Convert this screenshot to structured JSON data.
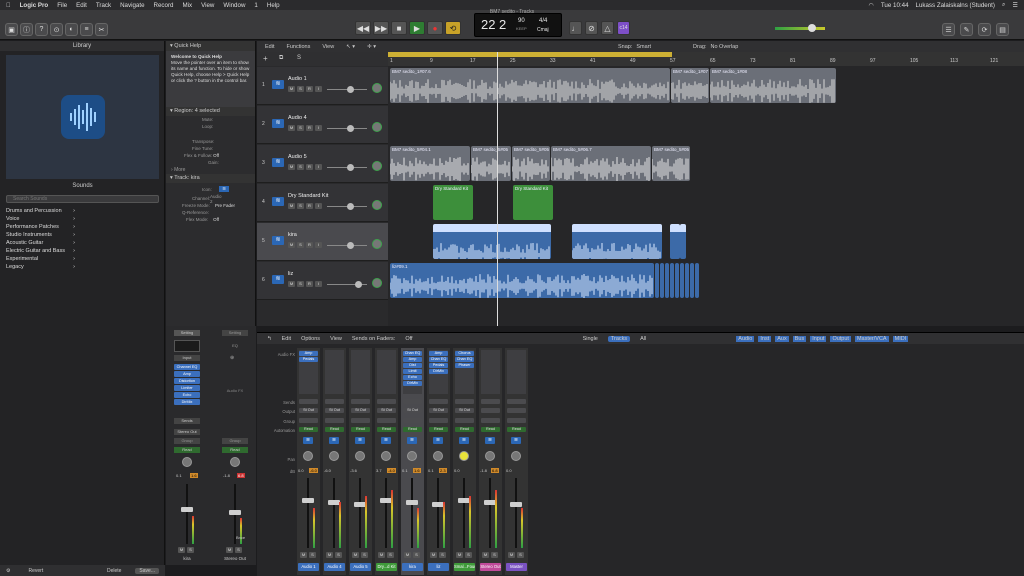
{
  "menubar": {
    "app": "Logic Pro",
    "items": [
      "File",
      "Edit",
      "Track",
      "Navigate",
      "Record",
      "Mix",
      "View",
      "Window",
      "1",
      "Help"
    ],
    "time": "Tue 10:44",
    "user": "Lukass Zalaiskalns (Student)"
  },
  "window_title": "BM7 sedito - Tracks",
  "lcd": {
    "bar": "22",
    "beat": "2",
    "tempo": "90",
    "tempo_label": "KEEP",
    "sig": "4/4",
    "key": "Cmaj"
  },
  "count_in": "c14",
  "library": {
    "title": "Library",
    "sounds_label": "Sounds",
    "search_placeholder": "Search Sounds",
    "items": [
      "Drums and Percussion",
      "Voice",
      "Performance Patches",
      "Studio Instruments",
      "Acoustic Guitar",
      "Electric Guitar and Bass",
      "Experimental",
      "Legacy"
    ],
    "footer": {
      "revert": "Revert",
      "delete": "Delete",
      "save": "Save..."
    }
  },
  "quick_help": {
    "title": "Quick Help",
    "heading": "Welcome to Quick Help",
    "body": "Move the pointer over an item to show its name and function. To hide or show Quick Help, choose Help > Quick Help or click the ? button in the control bar."
  },
  "region_inspector": {
    "title": "Region: 4 selected",
    "rows": [
      {
        "label": "Mute:",
        "value": ""
      },
      {
        "label": "Loop:",
        "value": ""
      },
      {
        "label": "Transpose:",
        "value": ""
      },
      {
        "label": "Fine Tune:",
        "value": ""
      },
      {
        "label": "Flex & Follow:",
        "value": "Off"
      },
      {
        "label": "Gain:",
        "value": ""
      }
    ],
    "more": "More"
  },
  "track_inspector": {
    "title": "Track: kira",
    "rows": [
      {
        "label": "Icon:",
        "value": ""
      },
      {
        "label": "Channel:",
        "value": "Audio 2"
      },
      {
        "label": "Freeze Mode:",
        "value": "Pre Fader"
      },
      {
        "label": "Q-Reference:",
        "value": ""
      },
      {
        "label": "Flex Mode:",
        "value": "Off"
      }
    ]
  },
  "inspector_strip": {
    "setting_left": "Setting",
    "setting_right": "Setting",
    "eq_label": "EQ",
    "link_left": "Input",
    "plugins": [
      "Channel EQ",
      "Amp",
      "Distortion",
      "Limiter",
      "Echo",
      "DirMix"
    ],
    "audio_fx_right": "Audio FX",
    "sends_label": "Sends",
    "output_left": "Stereo Out",
    "group_left": "Group",
    "group_right": "Group",
    "automation_left": "Read",
    "automation_right": "Read",
    "vol_left": "0.1",
    "peak_left": "1.6",
    "vol_right": "-1.8",
    "peak_right": "6.8",
    "bnce": "Bnce",
    "name_left": "kira",
    "name_right": "Stereo Out"
  },
  "tracks_toolbar": {
    "edit": "Edit",
    "functions": "Functions",
    "view": "View",
    "snap_label": "Snap:",
    "snap_value": "Smart",
    "drag_label": "Drag:",
    "drag_value": "No Overlap"
  },
  "ruler": [
    "1",
    "9",
    "17",
    "25",
    "33",
    "41",
    "49",
    "57",
    "65",
    "73",
    "81",
    "89",
    "97",
    "105",
    "113",
    "121"
  ],
  "tracks": [
    {
      "num": "1",
      "name": "Audio 1"
    },
    {
      "num": "2",
      "name": "Audio 4"
    },
    {
      "num": "3",
      "name": "Audio 5"
    },
    {
      "num": "4",
      "name": "Dry Standard Kit"
    },
    {
      "num": "5",
      "name": "kira"
    },
    {
      "num": "6",
      "name": "liz"
    }
  ],
  "regions": {
    "t1": [
      "BM7 sedito_1#07.6",
      "BM7 sedito_1#07",
      "BM7 sedito_1#08"
    ],
    "t3": [
      "BM7 sedito_5#04.1",
      "BM7 sedito_5#05",
      "BM7 sedito_5#05",
      "BM7 sedito_5#06.7",
      "BM7 sedito_5#05"
    ],
    "t4": [
      "Dry Standard Kit",
      "Dry Standard Kit"
    ],
    "t5": [
      "kira#0777",
      "kira#0778"
    ],
    "t6": [
      "liz#09.1"
    ]
  },
  "mixer": {
    "toolbar": {
      "edit": "Edit",
      "options": "Options",
      "view": "View",
      "sends_on_faders": "Sends on Faders:",
      "sends_value": "Off"
    },
    "view_tabs": [
      "Single",
      "Tracks",
      "All"
    ],
    "filters": [
      "Audio",
      "Inst",
      "Aux",
      "Bus",
      "Input",
      "Output",
      "Master/VCA",
      "MIDI"
    ],
    "row_labels": [
      "Audio FX",
      "Sends",
      "Output",
      "Group",
      "Automation",
      "Pan",
      "dB"
    ],
    "strips": [
      {
        "name": "Audio 1",
        "color": "#3b6fbd",
        "fx": [
          "Amp",
          "Pedals"
        ],
        "out": "St Out",
        "auto": "Read",
        "db": "0.0",
        "peak": "-6.0"
      },
      {
        "name": "Audio 4",
        "color": "#3b6fbd",
        "fx": [],
        "out": "St Out",
        "auto": "Read",
        "db": "-6.0",
        "peak": ""
      },
      {
        "name": "Audio 5",
        "color": "#3b6fbd",
        "fx": [],
        "out": "St Out",
        "auto": "Read",
        "db": "-3.6",
        "peak": ""
      },
      {
        "name": "Dry...d Kit",
        "color": "#3f9a3a",
        "fx": [],
        "out": "St Out",
        "auto": "Read",
        "db": "3.7",
        "peak": "-4.0"
      },
      {
        "name": "kira",
        "color": "#3b6fbd",
        "fx": [
          "Chan EQ",
          "Amp",
          "Dist",
          "Limit",
          "Echo",
          "DirMix"
        ],
        "out": "St Out",
        "auto": "Read",
        "db": "0.1",
        "peak": "1.6"
      },
      {
        "name": "liz",
        "color": "#3b6fbd",
        "fx": [
          "Amp",
          "Chan EQ",
          "Pedals",
          "DirMix"
        ],
        "out": "St Out",
        "auto": "Read",
        "db": "0.1",
        "peak": "2.3"
      },
      {
        "name": "Smal...Four",
        "color": "#3f9a3a",
        "fx": [
          "Chorus",
          "Chan EQ",
          "Phaser"
        ],
        "out": "St Out",
        "auto": "Read",
        "db": "0.0",
        "peak": ""
      },
      {
        "name": "Stereo Out",
        "color": "#c04a9a",
        "fx": [],
        "out": "",
        "auto": "Read",
        "db": "-1.8",
        "peak": "6.8"
      },
      {
        "name": "Master",
        "color": "#7a52c2",
        "fx": [],
        "out": "",
        "auto": "Read",
        "db": "0.0",
        "peak": ""
      }
    ]
  },
  "colors": {
    "audio_region": "#6b6f78",
    "blue_region": "#3c6aa8",
    "drum_region": "#3d8f3b",
    "cycle": "#cdb034"
  }
}
